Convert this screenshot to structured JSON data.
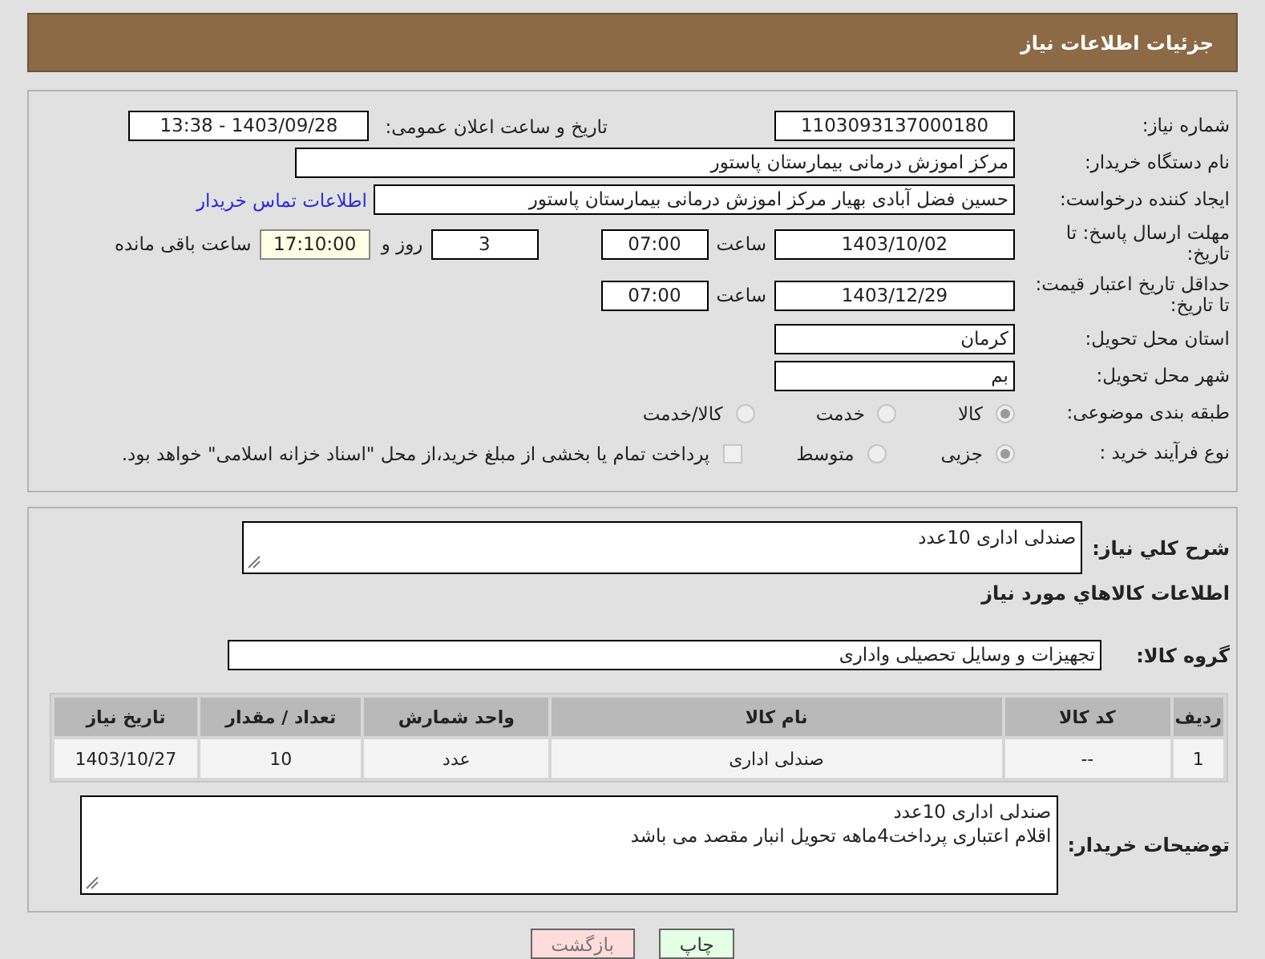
{
  "header": {
    "title": "جزئیات اطلاعات نیاز"
  },
  "details": {
    "need_number": {
      "label": "شماره نیاز:",
      "value": "1103093137000180"
    },
    "announce": {
      "label": "تاریخ و ساعت اعلان عمومی:",
      "value": "1403/09/28 - 13:38"
    },
    "buyer_org": {
      "label": "نام دستگاه خریدار:",
      "value": "مرکز اموزش درمانی بیمارستان پاستور"
    },
    "requester": {
      "label": "ایجاد کننده درخواست:",
      "value": "حسین فضل آبادی بهیار مرکز اموزش درمانی بیمارستان پاستور",
      "link": "اطلاعات تماس خریدار"
    },
    "reply_deadline": {
      "label": "مهلت ارسال پاسخ: تا تاریخ:",
      "date": "1403/10/02",
      "time_label": "ساعت",
      "time": "07:00",
      "days": "3",
      "days_label": "روز و",
      "remaining": "17:10:00",
      "remaining_label": "ساعت باقی مانده"
    },
    "price_validity": {
      "label": "حداقل تاریخ اعتبار قیمت: تا تاریخ:",
      "date": "1403/12/29",
      "time_label": "ساعت",
      "time": "07:00"
    },
    "province": {
      "label": "استان محل تحویل:",
      "value": "کرمان"
    },
    "city": {
      "label": "شهر محل تحویل:",
      "value": "بم"
    },
    "category": {
      "label": "طبقه بندی موضوعی:",
      "options": [
        {
          "label": "کالا",
          "selected": true
        },
        {
          "label": "خدمت",
          "selected": false
        },
        {
          "label": "کالا/خدمت",
          "selected": false
        }
      ]
    },
    "process": {
      "label": "نوع فرآیند خرید :",
      "options": [
        {
          "label": "جزیی",
          "selected": true
        },
        {
          "label": "متوسط",
          "selected": false
        }
      ],
      "treasury": {
        "label": "پرداخت تمام یا بخشی از مبلغ خرید،از محل \"اسناد خزانه اسلامی\" خواهد بود.",
        "checked": false
      }
    }
  },
  "summary": {
    "label": "شرح کلي نياز:",
    "value": "صندلی اداری 10عدد"
  },
  "items_title": "اطلاعات کالاهاي مورد نياز",
  "goods_group": {
    "label": "گروه کالا:",
    "value": "تجهیزات و وسایل تحصیلی واداری"
  },
  "table": {
    "columns": [
      "ردیف",
      "کد کالا",
      "نام کالا",
      "واحد شمارش",
      "تعداد / مقدار",
      "تاریخ نیاز"
    ],
    "rows": [
      [
        "1",
        "--",
        "صندلی اداری",
        "عدد",
        "10",
        "1403/10/27"
      ]
    ]
  },
  "buyer_notes": {
    "label": "توضیحات خریدار:",
    "lines": [
      "صندلی اداری 10عدد",
      "اقلام اعتباری پرداخت4ماهه تحویل انبار مقصد می باشد"
    ]
  },
  "buttons": [
    {
      "label": "چاپ",
      "kind": "print"
    },
    {
      "label": "بازگشت",
      "kind": "back"
    }
  ]
}
